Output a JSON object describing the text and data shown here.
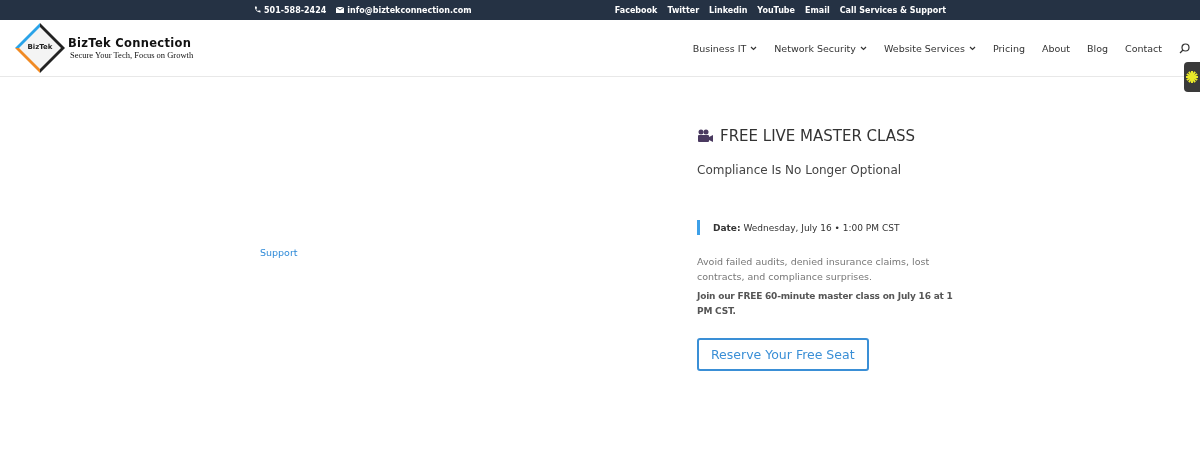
{
  "top_bar": {
    "phone": "501-588-2424",
    "email": "info@biztekconnection.com",
    "links": [
      "Facebook",
      "Twitter",
      "Linkedin",
      "YouTube",
      "Email",
      "Call Services & Support"
    ]
  },
  "header": {
    "logo": {
      "mark": "BizTek",
      "name": "BizTek Connection",
      "tagline": "Secure Your Tech, Focus on Growth"
    },
    "nav": [
      {
        "label": "Business IT",
        "dropdown": true
      },
      {
        "label": "Network Security",
        "dropdown": true
      },
      {
        "label": "Website Services",
        "dropdown": true
      },
      {
        "label": "Pricing",
        "dropdown": false
      },
      {
        "label": "About",
        "dropdown": false
      },
      {
        "label": "Blog",
        "dropdown": false
      },
      {
        "label": "Contact",
        "dropdown": false
      }
    ]
  },
  "left": {
    "link": "Support"
  },
  "promo": {
    "title": "FREE LIVE MASTER CLASS",
    "subtitle": "Compliance Is No Longer Optional",
    "date": "**Date:** Wednesday, July 16 • 1:00 PM CST",
    "body": "Avoid failed audits, denied insurance claims, lost contracts, and compliance surprises.",
    "cta_text": "Join our FREE 60-minute master class on July 16 at 1 PM CST.",
    "button": "Reserve Your Free Seat"
  }
}
